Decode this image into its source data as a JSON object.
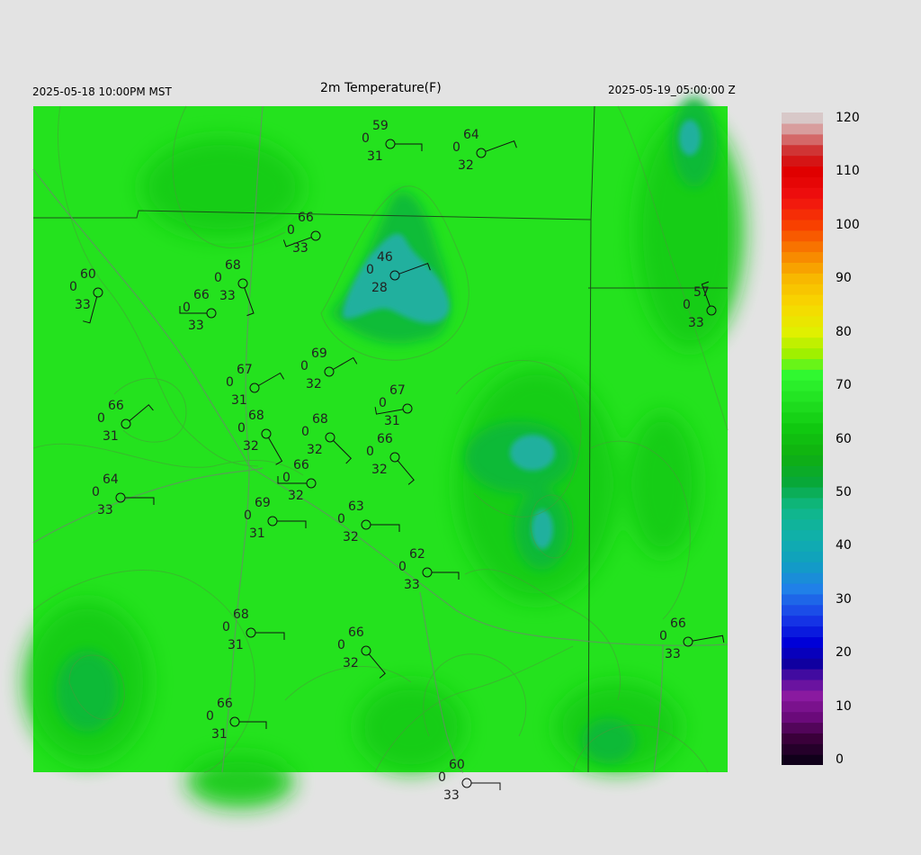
{
  "header": {
    "left": "2025-05-18 10:00PM MST",
    "title": "2m Temperature(F)",
    "right": "2025-05-19_05:00:00 Z"
  },
  "colorbar": {
    "ticks": [
      "0",
      "10",
      "20",
      "30",
      "40",
      "50",
      "60",
      "70",
      "80",
      "90",
      "100",
      "110",
      "120"
    ],
    "colors": {
      "base_field": "#22e61e",
      "warm_field": "#10d810",
      "cool_field": "#10b080",
      "cold_field": "#20b4a8"
    }
  },
  "stations": [
    {
      "temp": "59",
      "wind": "0",
      "dew": "31"
    },
    {
      "temp": "64",
      "wind": "0",
      "dew": "32"
    },
    {
      "temp": "66",
      "wind": "0",
      "dew": "33"
    },
    {
      "temp": "46",
      "wind": "0",
      "dew": "28"
    },
    {
      "temp": "68",
      "wind": "0",
      "dew": "33"
    },
    {
      "temp": "60",
      "wind": "0",
      "dew": "33"
    },
    {
      "temp": "66",
      "wind": "0",
      "dew": "33"
    },
    {
      "temp": "57",
      "wind": "0",
      "dew": "33"
    },
    {
      "temp": "69",
      "wind": "0",
      "dew": "32"
    },
    {
      "temp": "67",
      "wind": "0",
      "dew": "31"
    },
    {
      "temp": "67",
      "wind": "0",
      "dew": "31"
    },
    {
      "temp": "66",
      "wind": "0",
      "dew": "31"
    },
    {
      "temp": "68",
      "wind": "0",
      "dew": "32"
    },
    {
      "temp": "68",
      "wind": "0",
      "dew": "32"
    },
    {
      "temp": "66",
      "wind": "0",
      "dew": "32"
    },
    {
      "temp": "66",
      "wind": "0",
      "dew": "32"
    },
    {
      "temp": "64",
      "wind": "0",
      "dew": "33"
    },
    {
      "temp": "69",
      "wind": "0",
      "dew": "31"
    },
    {
      "temp": "63",
      "wind": "0",
      "dew": "32"
    },
    {
      "temp": "62",
      "wind": "0",
      "dew": "33"
    },
    {
      "temp": "68",
      "wind": "0",
      "dew": "31"
    },
    {
      "temp": "66",
      "wind": "0",
      "dew": "32"
    },
    {
      "temp": "66",
      "wind": "0",
      "dew": "33"
    },
    {
      "temp": "66",
      "wind": "0",
      "dew": "31"
    },
    {
      "temp": "60",
      "wind": "0",
      "dew": "33"
    }
  ]
}
